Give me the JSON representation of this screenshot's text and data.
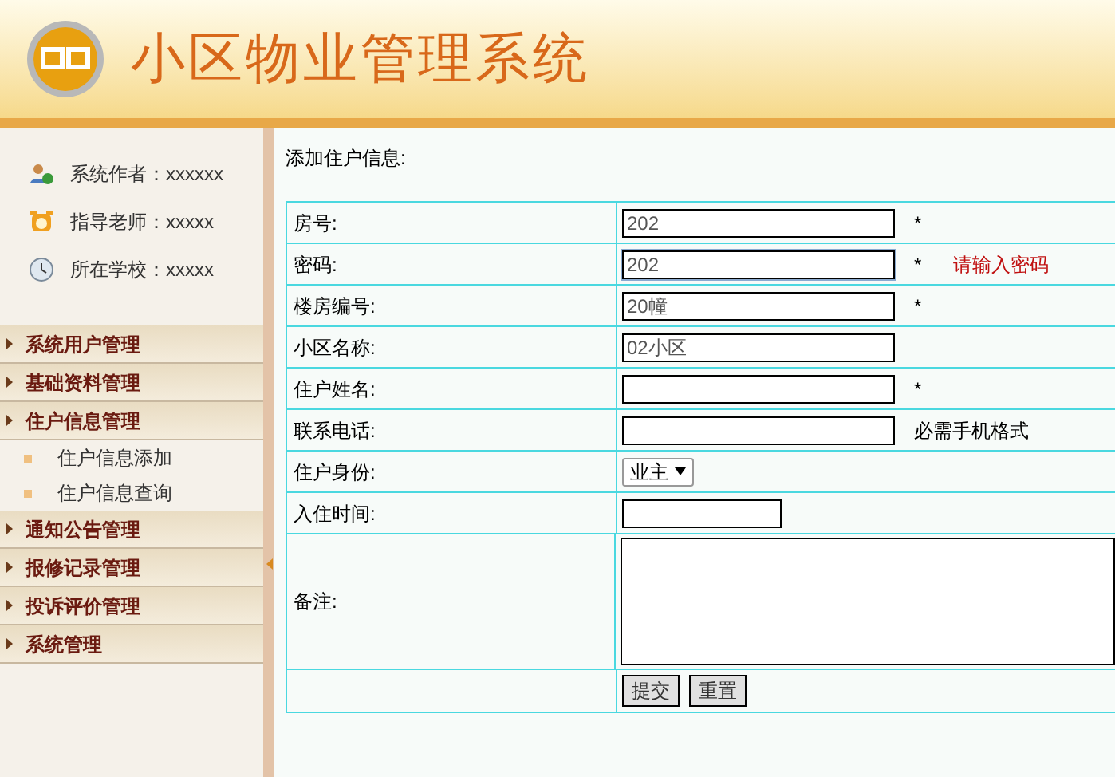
{
  "header": {
    "title": "小区物业管理系统"
  },
  "sidebar": {
    "info": [
      {
        "kind": "author",
        "label": "系统作者：xxxxxx"
      },
      {
        "kind": "teacher",
        "label": "指导老师：xxxxx"
      },
      {
        "kind": "school",
        "label": "所在学校：xxxxx"
      }
    ],
    "menu": [
      {
        "label": "系统用户管理"
      },
      {
        "label": "基础资料管理"
      },
      {
        "label": "住户信息管理",
        "children": [
          {
            "label": "住户信息添加"
          },
          {
            "label": "住户信息查询"
          }
        ]
      },
      {
        "label": "通知公告管理"
      },
      {
        "label": "报修记录管理"
      },
      {
        "label": "投诉评价管理"
      },
      {
        "label": "系统管理"
      }
    ]
  },
  "form": {
    "title": "添加住户信息:",
    "rows": [
      {
        "kind": "text",
        "label": "房号:",
        "value": "202",
        "mark": "*"
      },
      {
        "kind": "text",
        "label": "密码:",
        "value": "202",
        "mark": "*",
        "focused": true,
        "message": {
          "text": "请输入密码",
          "kind": "error"
        }
      },
      {
        "kind": "text",
        "label": "楼房编号:",
        "value": "20幢",
        "mark": "*"
      },
      {
        "kind": "text",
        "label": "小区名称:",
        "value": "02小区"
      },
      {
        "kind": "text",
        "label": "住户姓名:",
        "mark": "*"
      },
      {
        "kind": "text",
        "label": "联系电话:",
        "message": {
          "text": "必需手机格式",
          "kind": "hint"
        }
      },
      {
        "kind": "select",
        "label": "住户身份:",
        "value": "业主"
      },
      {
        "kind": "short",
        "label": "入住时间:"
      },
      {
        "kind": "textarea",
        "label": "备注:"
      }
    ],
    "buttons": [
      "提交",
      "重置"
    ]
  }
}
